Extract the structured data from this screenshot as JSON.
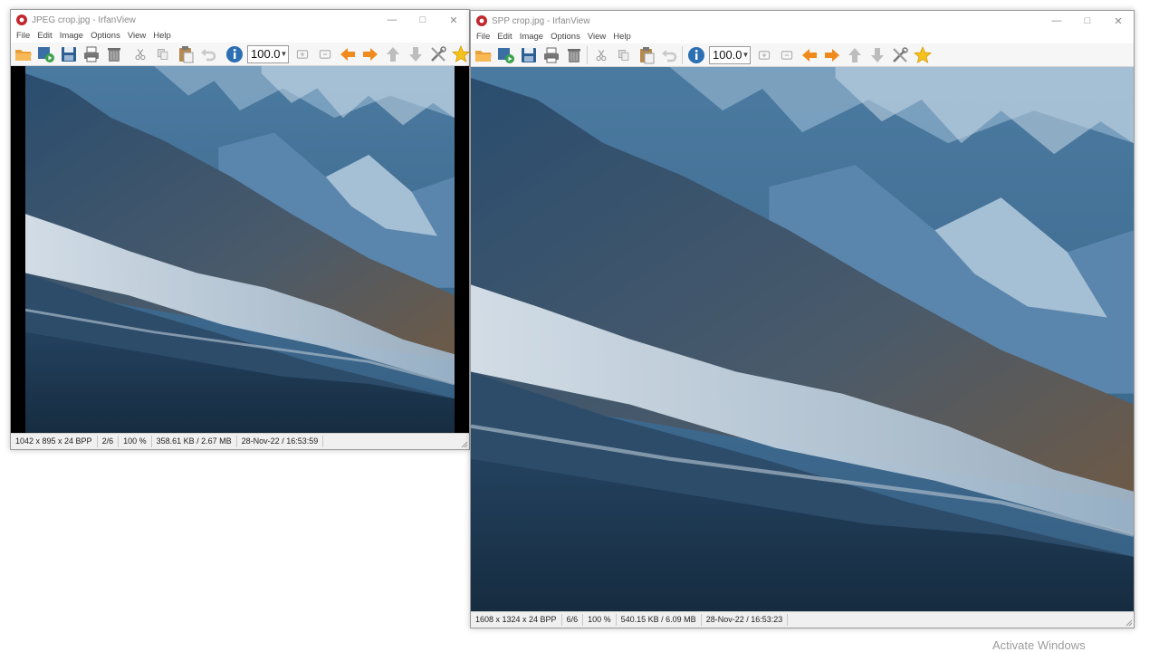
{
  "windows": [
    {
      "title": "JPEG crop.jpg - IrfanView",
      "menu": [
        "File",
        "Edit",
        "Image",
        "Options",
        "View",
        "Help"
      ],
      "zoom_value": "100.0",
      "status": [
        "1042 x 895 x 24 BPP",
        "2/6",
        "100 %",
        "358.61 KB / 2.67 MB",
        "28-Nov-22 / 16:53:59"
      ]
    },
    {
      "title": "SPP crop.jpg - IrfanView",
      "menu": [
        "File",
        "Edit",
        "Image",
        "Options",
        "View",
        "Help"
      ],
      "zoom_value": "100.0",
      "status": [
        "1608 x 1324 x 24 BPP",
        "6/6",
        "100 %",
        "540.15 KB / 6.09 MB",
        "28-Nov-22 / 16:53:23"
      ]
    }
  ],
  "caption_buttons": [
    "minimize",
    "maximize",
    "close"
  ],
  "toolbar_icons": [
    "open-folder-icon",
    "slideshow-icon",
    "save-icon",
    "print-icon",
    "delete-icon",
    "cut-icon",
    "copy-icon",
    "paste-icon",
    "undo-icon",
    "info-icon",
    "zoom-in-icon",
    "zoom-out-icon",
    "previous-icon",
    "next-icon",
    "first-icon",
    "last-icon",
    "properties-icon",
    "favorites-icon"
  ],
  "colors": {
    "folder": "#e8a13a",
    "arrow_orange": "#f08a1c",
    "info_blue": "#2c6fb3",
    "star": "#f5c21b",
    "sky_blue": "#3f6f96"
  },
  "os_watermark": "Activate Windows"
}
